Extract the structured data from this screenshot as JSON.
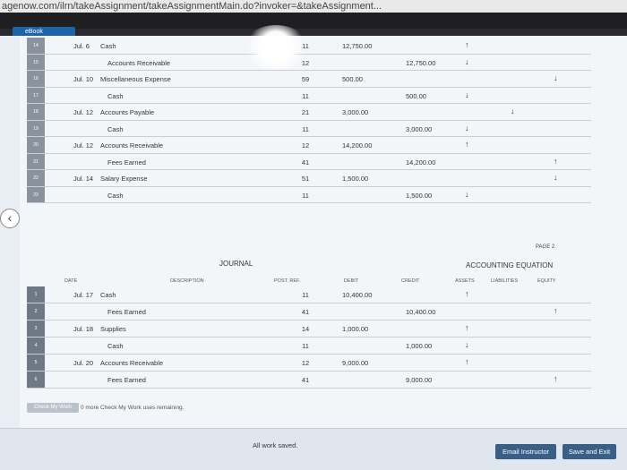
{
  "browser": {
    "url": "agenow.com/ilrn/takeAssignment/takeAssignmentMain.do?invoker=&takeAssignment..."
  },
  "tab": {
    "label": "eBook"
  },
  "journal_page1": {
    "rows": [
      {
        "num": "14",
        "date": "Jul. 6",
        "desc": "Cash",
        "indent": false,
        "post": "11",
        "debit": "12,750.00",
        "credit": "",
        "a1": "↑",
        "a2": "",
        "a3": ""
      },
      {
        "num": "15",
        "date": "",
        "desc": "Accounts Receivable",
        "indent": true,
        "post": "12",
        "debit": "",
        "credit": "12,750.00",
        "a1": "↓",
        "a2": "",
        "a3": ""
      },
      {
        "num": "16",
        "date": "Jul. 10",
        "desc": "Miscellaneous Expense",
        "indent": false,
        "post": "59",
        "debit": "500.00",
        "credit": "",
        "a1": "",
        "a2": "",
        "a3": "↓"
      },
      {
        "num": "17",
        "date": "",
        "desc": "Cash",
        "indent": true,
        "post": "11",
        "debit": "",
        "credit": "500.00",
        "a1": "↓",
        "a2": "",
        "a3": ""
      },
      {
        "num": "18",
        "date": "Jul. 12",
        "desc": "Accounts Payable",
        "indent": false,
        "post": "21",
        "debit": "3,000.00",
        "credit": "",
        "a1": "",
        "a2": "↓",
        "a3": ""
      },
      {
        "num": "19",
        "date": "",
        "desc": "Cash",
        "indent": true,
        "post": "11",
        "debit": "",
        "credit": "3,000.00",
        "a1": "↓",
        "a2": "",
        "a3": ""
      },
      {
        "num": "20",
        "date": "Jul. 12",
        "desc": "Accounts Receivable",
        "indent": false,
        "post": "12",
        "debit": "14,200.00",
        "credit": "",
        "a1": "↑",
        "a2": "",
        "a3": ""
      },
      {
        "num": "21",
        "date": "",
        "desc": "Fees Earned",
        "indent": true,
        "post": "41",
        "debit": "",
        "credit": "14,200.00",
        "a1": "",
        "a2": "",
        "a3": "↑"
      },
      {
        "num": "22",
        "date": "Jul. 14",
        "desc": "Salary Expense",
        "indent": false,
        "post": "51",
        "debit": "1,500.00",
        "credit": "",
        "a1": "",
        "a2": "",
        "a3": "↓"
      },
      {
        "num": "23",
        "date": "",
        "desc": "Cash",
        "indent": true,
        "post": "11",
        "debit": "",
        "credit": "1,500.00",
        "a1": "↓",
        "a2": "",
        "a3": ""
      }
    ]
  },
  "page2": {
    "page_label": "PAGE 2",
    "journal_title": "JOURNAL",
    "equation_title": "ACCOUNTING EQUATION",
    "headers": {
      "date": "DATE",
      "description": "DESCRIPTION",
      "post_ref": "POST. REF.",
      "debit": "DEBIT",
      "credit": "CREDIT",
      "assets": "ASSETS",
      "liabilities": "LIABILITIES",
      "equity": "EQUITY"
    },
    "rows": [
      {
        "num": "1",
        "date": "Jul. 17",
        "desc": "Cash",
        "indent": false,
        "post": "11",
        "debit": "10,400.00",
        "credit": "",
        "a1": "↑",
        "a2": "",
        "a3": ""
      },
      {
        "num": "2",
        "date": "",
        "desc": "Fees Earned",
        "indent": true,
        "post": "41",
        "debit": "",
        "credit": "10,400.00",
        "a1": "",
        "a2": "",
        "a3": "↑"
      },
      {
        "num": "3",
        "date": "Jul. 18",
        "desc": "Supplies",
        "indent": false,
        "post": "14",
        "debit": "1,000.00",
        "credit": "",
        "a1": "↑",
        "a2": "",
        "a3": ""
      },
      {
        "num": "4",
        "date": "",
        "desc": "Cash",
        "indent": true,
        "post": "11",
        "debit": "",
        "credit": "1,000.00",
        "a1": "↓",
        "a2": "",
        "a3": ""
      },
      {
        "num": "5",
        "date": "Jul. 20",
        "desc": "Accounts Receivable",
        "indent": false,
        "post": "12",
        "debit": "9,000.00",
        "credit": "",
        "a1": "↑",
        "a2": "",
        "a3": ""
      },
      {
        "num": "6",
        "date": "",
        "desc": "Fees Earned",
        "indent": true,
        "post": "41",
        "debit": "",
        "credit": "9,000.00",
        "a1": "",
        "a2": "",
        "a3": "↑"
      }
    ]
  },
  "check": {
    "button_label": "Check My Work",
    "remaining_text": "0 more Check My Work uses remaining."
  },
  "footer": {
    "status": "All work saved.",
    "email_label": "Email Instructor",
    "save_exit_label": "Save and Exit"
  },
  "colors": {
    "accent": "#3a5f86",
    "tab": "#1d63a8"
  }
}
